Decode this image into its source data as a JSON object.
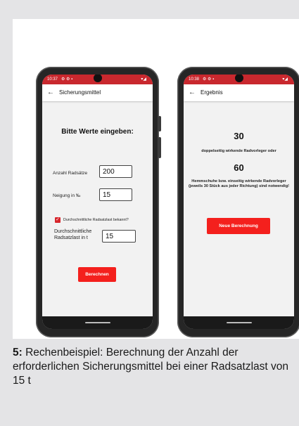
{
  "left_phone": {
    "status_time": "10:37",
    "status_icons": "⚙ ⚙ ▪",
    "status_signal": "▾◢",
    "appbar_title": "Sicherungsmittel",
    "heading": "Bitte Werte eingeben:",
    "field1_label": "Anzahl Radsätze",
    "field1_value": "200",
    "field2_label": "Neigung in ‰",
    "field2_value": "15",
    "checkbox_label": "Durchschnittliche Radsatzlast bekannt?",
    "checkbox_checked": true,
    "field3_label_line1": "Durchschnittliche",
    "field3_label_line2": "Radsatzlast in t",
    "field3_value": "15",
    "button_label": "Berechnen"
  },
  "right_phone": {
    "status_time": "10:38",
    "status_icons": "⚙ ⚙ ▪",
    "status_signal": "▾◢",
    "appbar_title": "Ergebnis",
    "result1": "30",
    "result1_text": "doppelseitig wirkende Radvorleger oder",
    "result2": "60",
    "result2_text": "Hemmschuhe bzw. einseitig wirkende Radvorleger (jeweils 30 Stück aus jeder Richtung) sind notwendig!",
    "button_label": "Neue Berechnung"
  },
  "caption": {
    "number": "5:",
    "text": " Rechenbeispiel: Berechnung der Anzahl der erforderlichen Sicherungsmittel bei einer Radsatzlast von 15 t"
  },
  "colors": {
    "accent": "#f4201d",
    "statusbar": "#c9282e",
    "background": "#e4e4e6"
  },
  "icons": {
    "back": "arrow-left-icon",
    "checkbox": "checkbox-checked-icon"
  }
}
